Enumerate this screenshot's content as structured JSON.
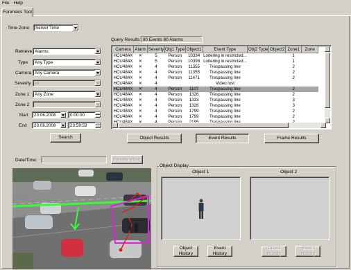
{
  "menu": [
    "File",
    "Help"
  ],
  "tab": "Forensics Tool",
  "timezone": {
    "label": "Time Zone:",
    "value": "Server Time"
  },
  "filters": [
    {
      "label": "Retrieve",
      "value": "Alarms",
      "disabled": false
    },
    {
      "label": "Type",
      "value": "Any Type",
      "disabled": false
    },
    {
      "label": "Camera",
      "value": "Any Camera",
      "disabled": false
    },
    {
      "label": "Severity",
      "value": "all",
      "disabled": true
    },
    {
      "label": "Zone 1",
      "value": "Any Zone",
      "disabled": false
    },
    {
      "label": "Zone 2",
      "value": "",
      "disabled": true
    }
  ],
  "start": {
    "label": "Start",
    "date": "23.06.2008",
    "time": "0:00:00"
  },
  "end": {
    "label": "End",
    "date": "23.06.2008",
    "time": "23:59:59"
  },
  "search_button": "Search",
  "query": {
    "label": "Query Results:",
    "value": "80 Events 80 Alarms"
  },
  "table": {
    "columns": [
      "Camera",
      "Alarm",
      "Severity",
      "Obj1 Type",
      "Object1",
      "Event Type",
      "Obj2 Type",
      "Object2",
      "Zone1",
      "Zone"
    ],
    "rows": [
      [
        "HCU484X",
        "✕",
        "5",
        "Person",
        "10334",
        "Loitering in restricted...",
        "",
        "",
        "1",
        ""
      ],
      [
        "HCU484X",
        "✕",
        "5",
        "Person",
        "10398",
        "Loitering in restricted...",
        "",
        "",
        "1",
        ""
      ],
      [
        "HCU484X",
        "✕",
        "4",
        "Person",
        "11355",
        "Trespassing line",
        "",
        "",
        "2",
        ""
      ],
      [
        "HCU484X",
        "✕",
        "4",
        "Person",
        "11355",
        "Trespassing line",
        "",
        "",
        "2",
        ""
      ],
      [
        "HCU484X",
        "✕",
        "4",
        "Person",
        "11471",
        "Trespassing line",
        "",
        "",
        "2",
        ""
      ],
      [
        "HCU484X",
        "✕",
        "4",
        "",
        "",
        "Video lost",
        "",
        "",
        "",
        ""
      ],
      [
        "HCU484X",
        "✕",
        "4",
        "Person",
        "1107",
        "Trespassing line",
        "",
        "",
        "2",
        ""
      ],
      [
        "HCU484X",
        "✕",
        "4",
        "Person",
        "1326",
        "Trespassing line",
        "",
        "",
        "2",
        ""
      ],
      [
        "HCU484X",
        "✕",
        "4",
        "Person",
        "1333",
        "Trespassing line",
        "",
        "",
        "3",
        ""
      ],
      [
        "HCU484X",
        "✕",
        "4",
        "Person",
        "1326",
        "Trespassing line",
        "",
        "",
        "3",
        ""
      ],
      [
        "HCU484X",
        "✕",
        "4",
        "Person",
        "1799",
        "Trespassing line",
        "",
        "",
        "2",
        ""
      ],
      [
        "HCU484X",
        "✕",
        "4",
        "Person",
        "1799",
        "Trespassing line",
        "",
        "",
        "2",
        ""
      ],
      [
        "HCU484X",
        "✕",
        "4",
        "Person",
        "2195",
        "Trespassing line",
        "",
        "",
        "2",
        ""
      ]
    ],
    "selected_row": 6
  },
  "result_buttons": {
    "object": "Object Results",
    "event": "Event Results",
    "frame": "Frame Results"
  },
  "datetime": {
    "label": "Date/Time:",
    "value": ""
  },
  "review_button": "Review video",
  "object_display": {
    "title": "Object Display",
    "object1": "Object 1",
    "object2": "Object 2",
    "buttons": {
      "obj1_history": "Object History",
      "obj1_event": "Event History",
      "obj2_history": "Object History",
      "obj2_event": "Event History"
    }
  },
  "colors": {
    "selection": "#a6a6a6",
    "tripwire": "#33ff33",
    "zone": "#e020e0",
    "track": "#e02020"
  }
}
